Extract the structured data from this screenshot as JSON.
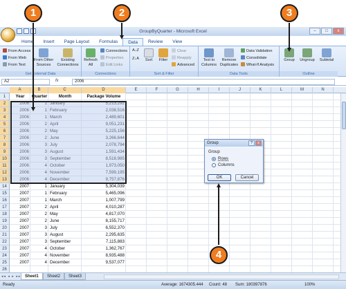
{
  "window": {
    "title": "GroupByQuarter - Microsoft Excel",
    "minimize": "–",
    "restore": "□",
    "close": "x"
  },
  "tabs": [
    "Home",
    "Insert",
    "Page Layout",
    "Formulas",
    "Data",
    "Review",
    "View"
  ],
  "active_tab": "Data",
  "ribbon": {
    "external_data": {
      "items": [
        "From Access",
        "From Web",
        "From Text"
      ],
      "from_other_sources": "From Other Sources",
      "existing_connections": "Existing Connections",
      "label": "Get External Data"
    },
    "connections": {
      "refresh_all": "Refresh All",
      "items": [
        "Connections",
        "Properties",
        "Edit Links"
      ],
      "label": "Connections"
    },
    "sort_filter": {
      "sort_az": "A↓Z",
      "sort_za": "Z↓A",
      "sort": "Sort",
      "filter": "Filter",
      "items": [
        "Clear",
        "Reapply",
        "Advanced"
      ],
      "label": "Sort & Filter"
    },
    "data_tools": {
      "text_to_columns": "Text to Columns",
      "remove_duplicates": "Remove Duplicates",
      "items": [
        "Data Validation",
        "Consolidate",
        "What-If Analysis"
      ],
      "label": "Data Tools"
    },
    "outline": {
      "group": "Group",
      "ungroup": "Ungroup",
      "subtotal": "Subtotal",
      "label": "Outline"
    }
  },
  "formula_bar": {
    "name_box": "A2",
    "fx": "fx",
    "value": "2006"
  },
  "columns": [
    "A",
    "B",
    "C",
    "D",
    "E",
    "F",
    "G",
    "H",
    "I",
    "J",
    "K",
    "L",
    "M",
    "N"
  ],
  "headers": [
    "Year",
    "Quarter",
    "Month",
    "Package Volume"
  ],
  "rows": [
    [
      "2006",
      "1",
      "January",
      "5,213,292"
    ],
    [
      "2006",
      "1",
      "February",
      "2,038,516"
    ],
    [
      "2006",
      "1",
      "March",
      "2,489,601"
    ],
    [
      "2006",
      "2",
      "April",
      "9,051,231"
    ],
    [
      "2006",
      "2",
      "May",
      "5,225,156"
    ],
    [
      "2006",
      "2",
      "June",
      "3,266,644"
    ],
    [
      "2006",
      "3",
      "July",
      "2,078,794"
    ],
    [
      "2006",
      "3",
      "August",
      "1,591,434"
    ],
    [
      "2006",
      "3",
      "September",
      "8,518,985"
    ],
    [
      "2006",
      "4",
      "October",
      "1,973,050"
    ],
    [
      "2006",
      "4",
      "November",
      "7,599,195"
    ],
    [
      "2006",
      "4",
      "December",
      "9,757,876"
    ],
    [
      "2007",
      "1",
      "January",
      "5,304,039"
    ],
    [
      "2007",
      "1",
      "February",
      "5,465,096"
    ],
    [
      "2007",
      "1",
      "March",
      "1,007,799"
    ],
    [
      "2007",
      "2",
      "April",
      "4,010,287"
    ],
    [
      "2007",
      "2",
      "May",
      "4,817,070"
    ],
    [
      "2007",
      "2",
      "June",
      "8,155,717"
    ],
    [
      "2007",
      "3",
      "July",
      "6,552,370"
    ],
    [
      "2007",
      "3",
      "August",
      "2,295,635"
    ],
    [
      "2007",
      "3",
      "September",
      "7,115,883"
    ],
    [
      "2007",
      "4",
      "October",
      "1,362,767"
    ],
    [
      "2007",
      "4",
      "November",
      "8,935,488"
    ],
    [
      "2007",
      "4",
      "December",
      "9,537,077"
    ]
  ],
  "row_numbers": [
    "1",
    "2",
    "3",
    "4",
    "5",
    "6",
    "7",
    "8",
    "9",
    "10",
    "11",
    "12",
    "13",
    "14",
    "15",
    "16",
    "17",
    "18",
    "19",
    "20",
    "21",
    "22",
    "23",
    "24",
    "25",
    "26"
  ],
  "sheets": [
    "Sheet1",
    "Sheet2",
    "Sheet3"
  ],
  "sheet_nav": "◂◂ ◂ ▸ ▸▸",
  "status": {
    "ready": "Ready",
    "average": "Average: 1674305.444",
    "count": "Count: 48",
    "sum": "Sum: 180397876",
    "zoom": "100%"
  },
  "dialog": {
    "title": "Group",
    "help": "?",
    "close": "x",
    "label": "Group",
    "options": [
      "Rows",
      "Columns"
    ],
    "selected": "Rows",
    "ok": "OK",
    "cancel": "Cancel"
  },
  "callouts": [
    "1",
    "2",
    "3",
    "4"
  ],
  "colors": {
    "callout": "#ef7d1f",
    "selection": "#b4c8eb",
    "ribbon": "#d6e4f6",
    "header_selected": "#f9d99f"
  }
}
